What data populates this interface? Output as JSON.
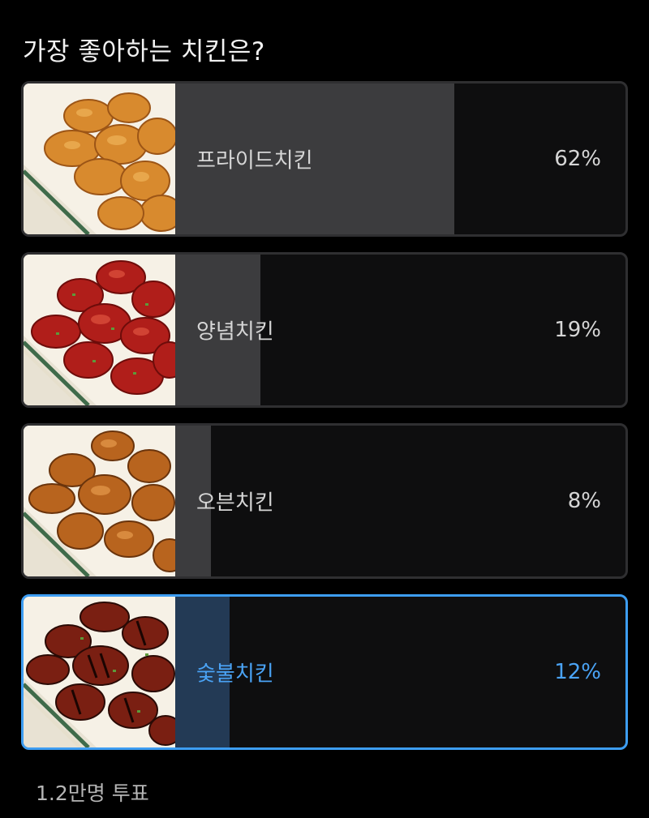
{
  "poll": {
    "question": "가장 좋아하는 치킨은?",
    "options": [
      {
        "label": "프라이드치킨",
        "percent_text": "62%",
        "percent": 62,
        "selected": false,
        "image": "fried-chicken-image"
      },
      {
        "label": "양념치킨",
        "percent_text": "19%",
        "percent": 19,
        "selected": false,
        "image": "seasoned-chicken-image"
      },
      {
        "label": "오븐치킨",
        "percent_text": "8%",
        "percent": 8,
        "selected": false,
        "image": "oven-chicken-image"
      },
      {
        "label": "숯불치킨",
        "percent_text": "12%",
        "percent": 12,
        "selected": true,
        "image": "charcoal-chicken-image"
      }
    ],
    "vote_count": "1.2만명 투표"
  },
  "colors": {
    "selected_accent": "#3d9df2",
    "result_fill": "#3c3c3e",
    "selected_fill": "#233a55",
    "card_background": "#0e0e0f"
  }
}
